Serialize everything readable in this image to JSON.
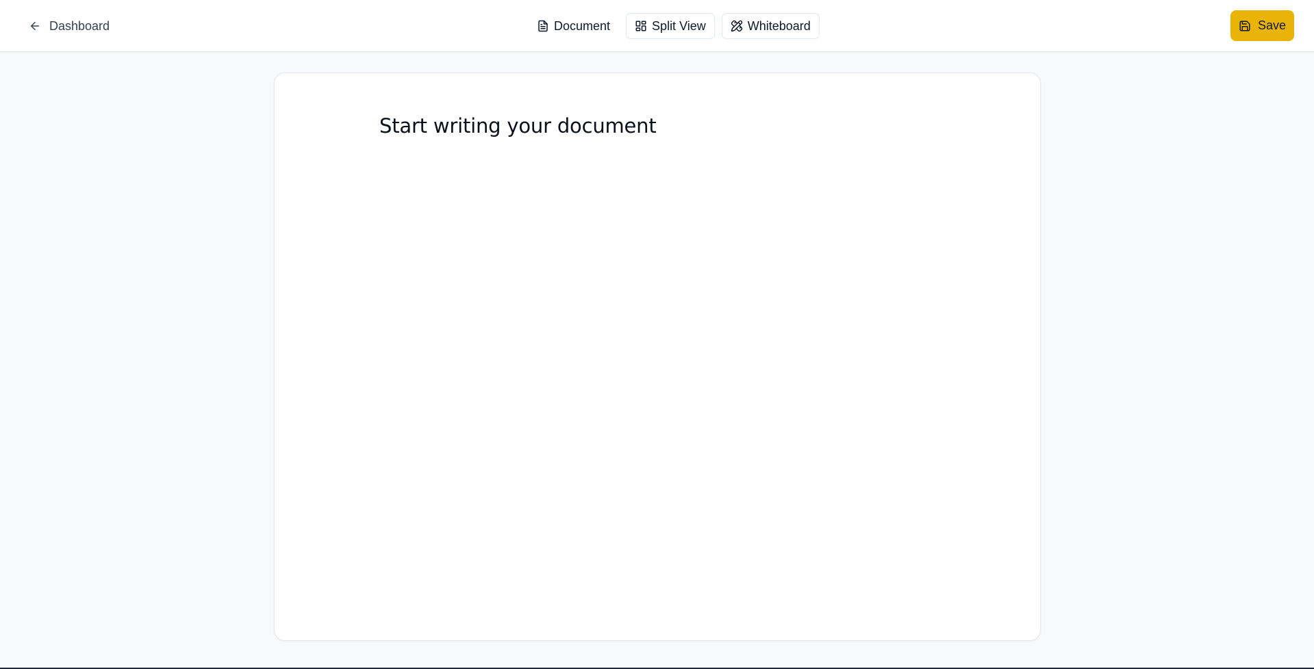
{
  "header": {
    "back_label": "Dashboard",
    "back_icon": "arrow-left-icon",
    "modes": [
      {
        "label": "Document",
        "icon": "file-text-icon",
        "active": true
      },
      {
        "label": "Split View",
        "icon": "layout-grid-icon",
        "active": false
      },
      {
        "label": "Whiteboard",
        "icon": "pencil-ruler-icon",
        "active": false
      }
    ],
    "save_label": "Save",
    "save_icon": "save-icon"
  },
  "editor": {
    "placeholder_title": "Start writing your document"
  },
  "colors": {
    "accent": "#eab308",
    "background": "#f8f9fb",
    "card": "#ffffff",
    "border": "#e5e7eb"
  }
}
